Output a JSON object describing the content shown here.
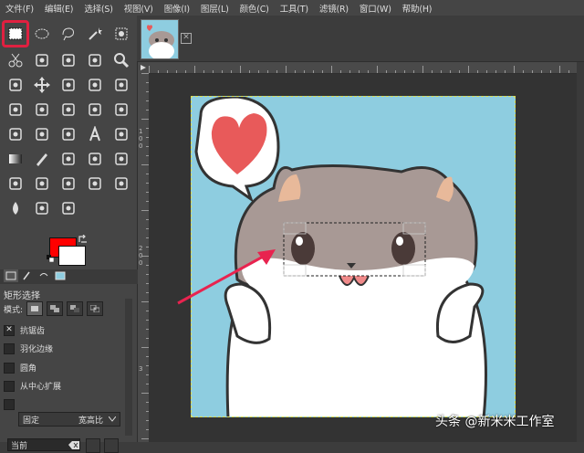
{
  "menu": [
    "文件(F)",
    "编辑(E)",
    "选择(S)",
    "视图(V)",
    "图像(I)",
    "图层(L)",
    "颜色(C)",
    "工具(T)",
    "滤镜(R)",
    "窗口(W)",
    "帮助(H)"
  ],
  "colors": {
    "foreground": "#ff0000",
    "background": "#ffffff",
    "highlight": "#e02040",
    "arrow": "#e8234f"
  },
  "tool_options": {
    "title": "矩形选择",
    "mode_label": "模式:",
    "antialias_label": "抗锯齿",
    "antialias_checked": "✕",
    "feather_label": "羽化边缘",
    "rounded_label": "圆角",
    "expand_center_label": "从中心扩展",
    "fixed_label": "固定",
    "fixed_value": "宽高比",
    "current_entry": "当前"
  },
  "image_tab": {
    "close_label": "✕"
  },
  "ruler_v_labels": [
    "1",
    "0",
    "0",
    "2",
    "0",
    "0",
    "3"
  ],
  "watermark": "头条 @新米米工作室",
  "tools": [
    "rect-select-icon",
    "ellipse-select-icon",
    "free-select-icon",
    "fuzzy-select-icon",
    "color-select-icon",
    "scissors-icon",
    "foreground-select-icon",
    "paths-icon",
    "color-picker-icon",
    "zoom-icon",
    "measure-icon",
    "move-icon",
    "align-icon",
    "crop-icon",
    "rotate-icon",
    "scale-icon",
    "shear-icon",
    "perspective-icon",
    "3d-transform-icon",
    "unified-transform-icon",
    "flip-icon",
    "cage-icon",
    "warp-icon",
    "text-icon",
    "bucket-fill-icon",
    "gradient-icon",
    "pencil-icon",
    "paintbrush-icon",
    "eraser-icon",
    "airbrush-icon",
    "ink-icon",
    "mypaint-brush-icon",
    "clone-icon",
    "heal-icon",
    "perspective-clone-icon",
    "blur-icon",
    "smudge-icon",
    "dodge-burn-icon"
  ]
}
